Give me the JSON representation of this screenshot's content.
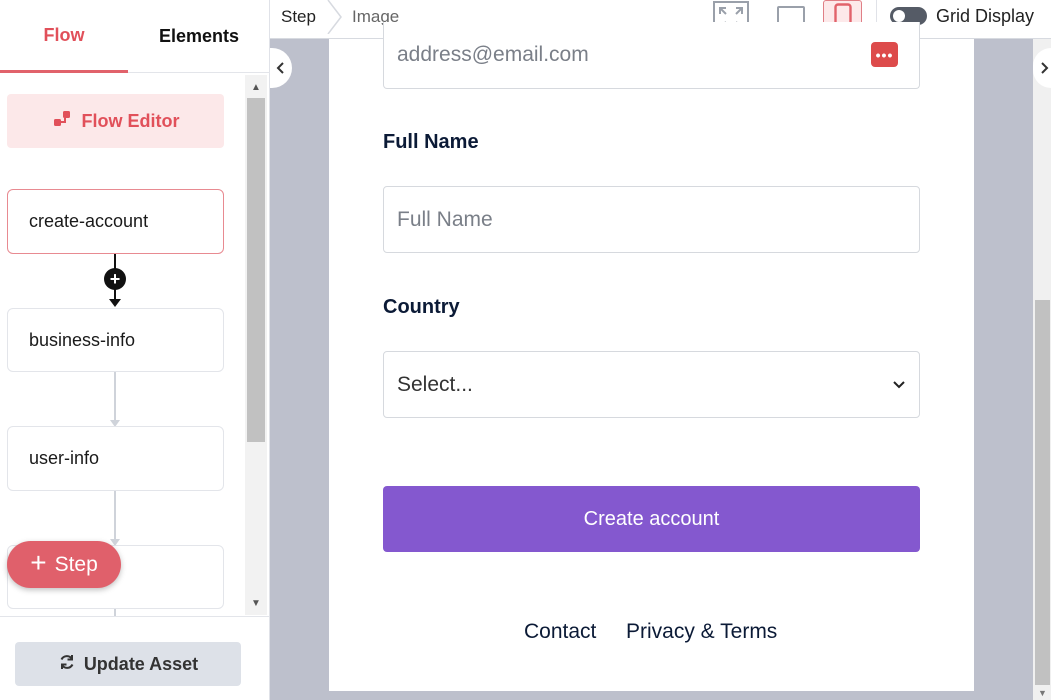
{
  "left_panel": {
    "tabs": [
      {
        "label": "Flow",
        "active": true
      },
      {
        "label": "Elements",
        "active": false
      }
    ],
    "flow_editor_label": "Flow Editor",
    "steps": [
      {
        "label": "create-account",
        "active": true
      },
      {
        "label": "business-info",
        "active": false
      },
      {
        "label": "user-info",
        "active": false
      },
      {
        "label": "",
        "active": false
      }
    ],
    "add_step_label": "Step",
    "update_asset_label": "Update Asset"
  },
  "topbar": {
    "breadcrumb": [
      "Step",
      "Image"
    ],
    "view_modes": [
      "fullscreen-icon",
      "laptop-icon",
      "mobile-icon"
    ],
    "active_view": "mobile",
    "grid_display_label": "Grid Display",
    "grid_display_on": false
  },
  "form": {
    "email_placeholder": "address@email.com",
    "email_badge": "•••",
    "full_name_label": "Full Name",
    "full_name_placeholder": "Full Name",
    "country_label": "Country",
    "country_value": "Select...",
    "submit_label": "Create account",
    "footer_links": [
      "Contact",
      "Privacy & Terms"
    ]
  },
  "colors": {
    "accent": "#e1505a",
    "primary_button": "#8458cf",
    "canvas_bg": "#bdc0cc"
  }
}
